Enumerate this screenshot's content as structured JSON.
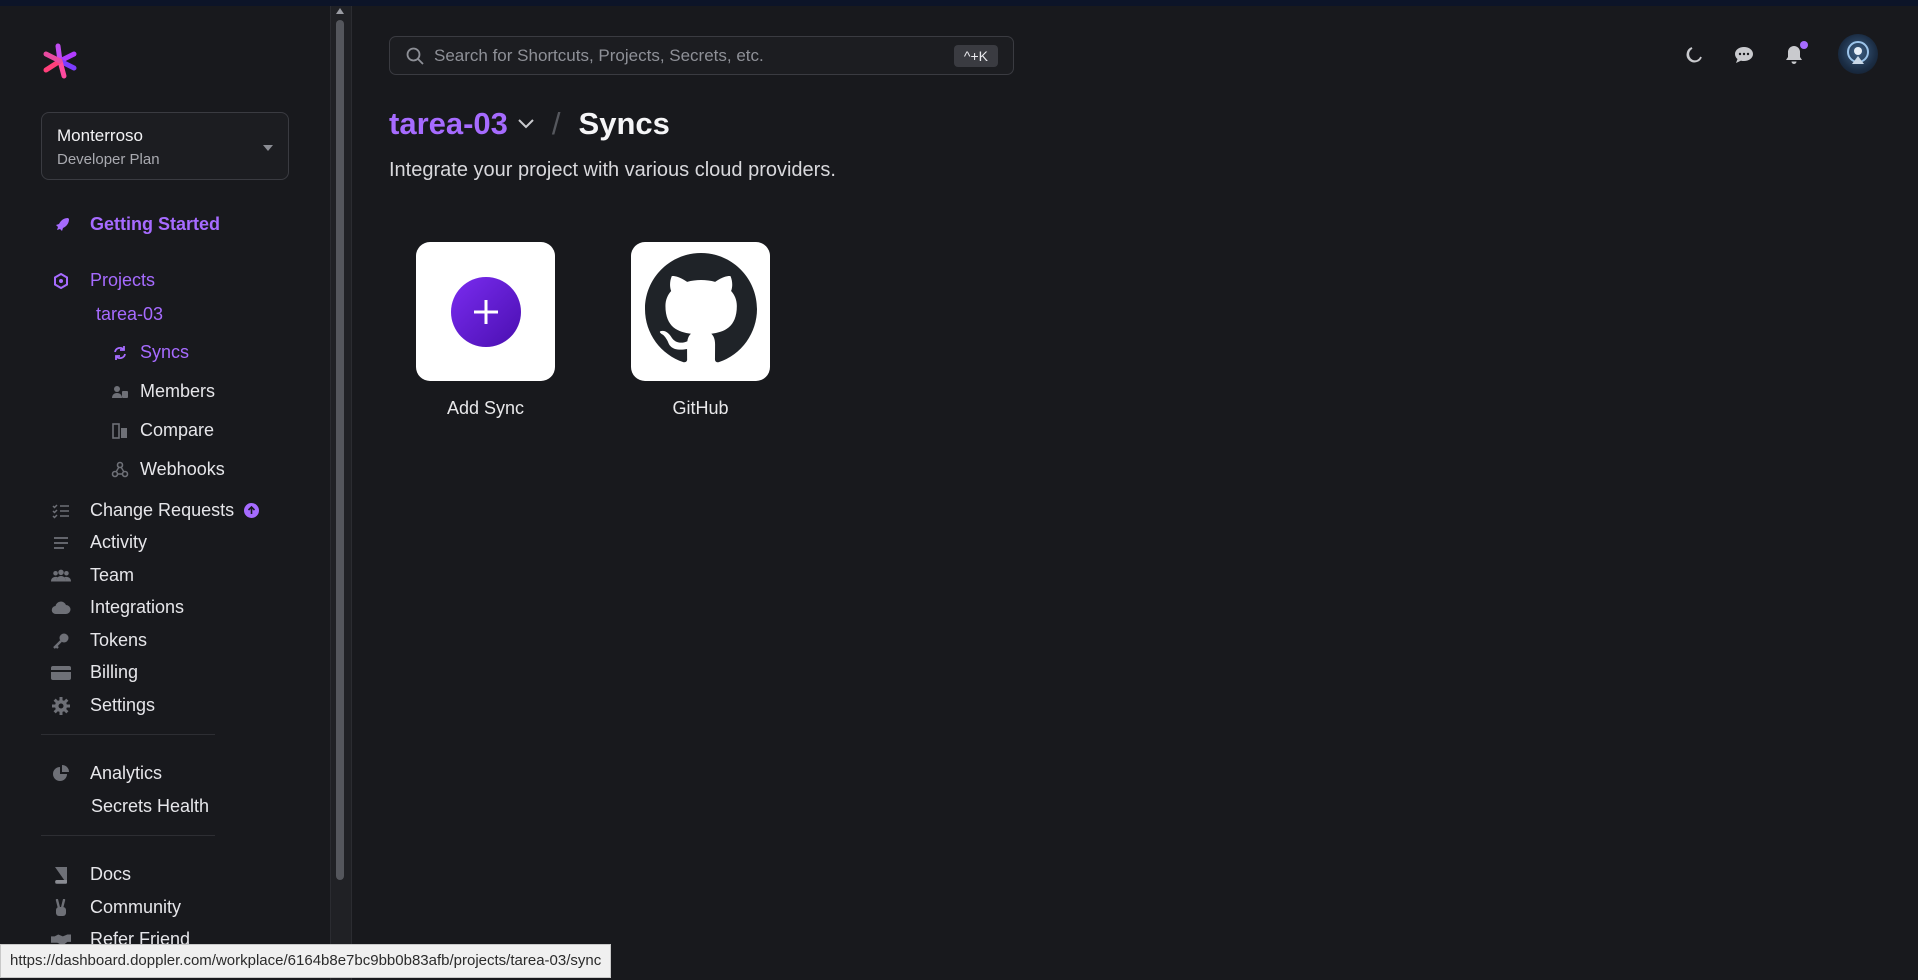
{
  "org": {
    "name": "Monterroso",
    "plan": "Developer Plan"
  },
  "sidebar": {
    "getting_started": "Getting Started",
    "projects": "Projects",
    "project_name": "tarea-03",
    "project_sub": [
      "Syncs",
      "Members",
      "Compare",
      "Webhooks"
    ],
    "change_requests": "Change Requests",
    "activity": "Activity",
    "team": "Team",
    "integrations": "Integrations",
    "tokens": "Tokens",
    "billing": "Billing",
    "settings": "Settings",
    "analytics": "Analytics",
    "secrets_health": "Secrets Health",
    "docs": "Docs",
    "community": "Community",
    "refer_friend": "Refer Friend"
  },
  "search": {
    "placeholder": "Search for Shortcuts, Projects, Secrets, etc.",
    "shortcut": "^+K"
  },
  "header": {
    "project": "tarea-03",
    "separator": "/",
    "page": "Syncs"
  },
  "main": {
    "subtitle": "Integrate your project with various cloud providers.",
    "tiles": [
      {
        "label": "Add Sync"
      },
      {
        "label": "GitHub"
      }
    ]
  },
  "status_url": "https://dashboard.doppler.com/workplace/6164b8e7bc9bb0b83afb/projects/tarea-03/sync",
  "colors": {
    "accent": "#a66bff",
    "background": "#18191d",
    "plus_gradient": [
      "#7a2cf0",
      "#4a0fb0"
    ]
  }
}
